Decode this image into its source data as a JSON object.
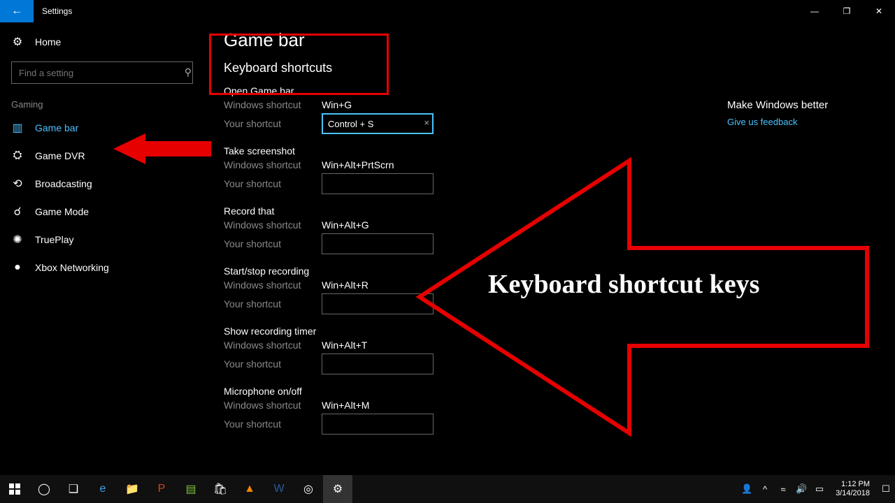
{
  "window": {
    "title": "Settings"
  },
  "sidebar": {
    "home": "Home",
    "search_placeholder": "Find a setting",
    "group": "Gaming",
    "items": [
      {
        "label": "Game bar"
      },
      {
        "label": "Game DVR"
      },
      {
        "label": "Broadcasting"
      },
      {
        "label": "Game Mode"
      },
      {
        "label": "TruePlay"
      },
      {
        "label": "Xbox Networking"
      }
    ]
  },
  "page": {
    "heading": "Game bar",
    "section": "Keyboard shortcuts"
  },
  "shortcuts": [
    {
      "title": "Open Game bar",
      "win_label": "Windows shortcut",
      "win_value": "Win+G",
      "your_label": "Your shortcut",
      "your_value": "Control + S",
      "focused": true
    },
    {
      "title": "Take screenshot",
      "win_label": "Windows shortcut",
      "win_value": "Win+Alt+PrtScrn",
      "your_label": "Your shortcut",
      "your_value": "",
      "focused": false
    },
    {
      "title": "Record that",
      "win_label": "Windows shortcut",
      "win_value": "Win+Alt+G",
      "your_label": "Your shortcut",
      "your_value": "",
      "focused": false
    },
    {
      "title": "Start/stop recording",
      "win_label": "Windows shortcut",
      "win_value": "Win+Alt+R",
      "your_label": "Your shortcut",
      "your_value": "",
      "focused": false
    },
    {
      "title": "Show recording timer",
      "win_label": "Windows shortcut",
      "win_value": "Win+Alt+T",
      "your_label": "Your shortcut",
      "your_value": "",
      "focused": false
    },
    {
      "title": "Microphone on/off",
      "win_label": "Windows shortcut",
      "win_value": "Win+Alt+M",
      "your_label": "Your shortcut",
      "your_value": "",
      "focused": false
    }
  ],
  "right": {
    "heading": "Make Windows better",
    "link": "Give us feedback"
  },
  "annotations": {
    "big_arrow_text": "Keyboard shortcut keys"
  },
  "taskbar": {
    "time": "1:12 PM",
    "date": "3/14/2018"
  }
}
